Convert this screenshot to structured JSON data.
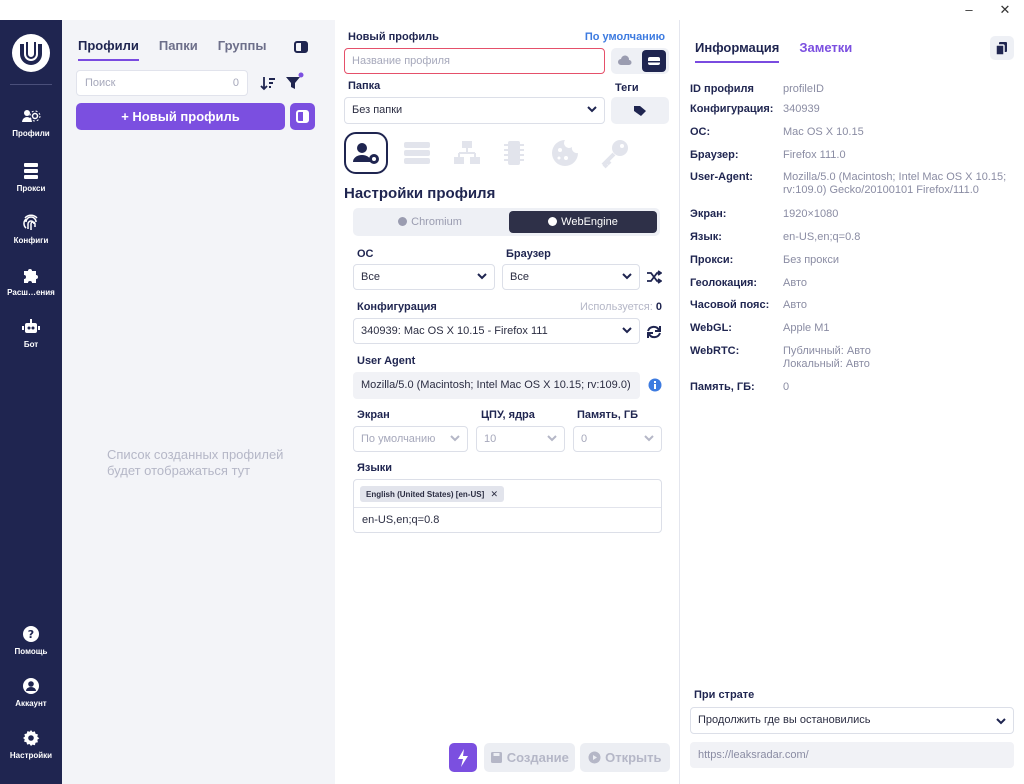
{
  "window": {
    "minimize": "–",
    "close": "✕"
  },
  "sidebar": {
    "items": [
      {
        "label": "Профили",
        "icon": "profiles-icon"
      },
      {
        "label": "Прокси",
        "icon": "proxy-icon"
      },
      {
        "label": "Конфиги",
        "icon": "fingerprint-icon"
      },
      {
        "label": "Расш…ения",
        "icon": "puzzle-icon"
      },
      {
        "label": "Бот",
        "icon": "robot-icon"
      }
    ],
    "bottom": [
      {
        "label": "Помощь",
        "icon": "help-icon"
      },
      {
        "label": "Аккаунт",
        "icon": "account-icon"
      },
      {
        "label": "Настройки",
        "icon": "gear-icon"
      }
    ]
  },
  "profiles": {
    "tabs": [
      "Профили",
      "Папки",
      "Группы"
    ],
    "search_placeholder": "Поиск",
    "search_count": "0",
    "new_profile_label": "+ Новый профиль",
    "empty_message": "Список созданных профилей будет отображаться тут"
  },
  "form": {
    "new_profile_label": "Новый профиль",
    "default_link": "По умолчанию",
    "name_placeholder": "Название профиля",
    "folder_label": "Папка",
    "tags_label": "Теги",
    "folder_value": "Без папки",
    "section_title": "Настройки профиля",
    "engines": [
      "Chromium",
      "WebEngine"
    ],
    "active_engine": "WebEngine",
    "os_label": "ОС",
    "os_value": "Все",
    "browser_label": "Браузер",
    "browser_value": "Все",
    "config_label": "Конфигурация",
    "used_label": "Используется:",
    "used_count": "0",
    "config_value": "340939: Mac OS X 10.15 - Firefox 111",
    "ua_label": "User Agent",
    "ua_value": "Mozilla/5.0 (Macintosh; Intel Mac OS X 10.15; rv:109.0)",
    "screen_label": "Экран",
    "screen_value": "По умолчанию",
    "cpu_label": "ЦПУ, ядра",
    "cpu_value": "10",
    "mem_label": "Память, ГБ",
    "mem_value": "0",
    "langs_label": "Языки",
    "lang_chip": "English (United States) [en-US]",
    "lang_chip_remove": "✕",
    "langs_value": "en-US,en;q=0.8",
    "create_label": "Создание",
    "open_label": "Открыть"
  },
  "info": {
    "tabs": [
      "Информация",
      "Заметки"
    ],
    "rows": [
      {
        "key": "ID профиля",
        "value": "profileID"
      },
      {
        "key": "Конфигурация:",
        "value": "340939"
      },
      {
        "key": "ОС:",
        "value": "Mac OS X 10.15"
      },
      {
        "key": "Браузер:",
        "value": "Firefox 111.0"
      },
      {
        "key": "User-Agent:",
        "value": "Mozilla/5.0 (Macintosh; Intel Mac OS X 10.15; rv:109.0) Gecko/20100101 Firefox/111.0"
      },
      {
        "key": "Экран:",
        "value": "1920×1080"
      },
      {
        "key": "Язык:",
        "value": "en-US,en;q=0.8"
      },
      {
        "key": "Прокси:",
        "value": "Без прокси"
      },
      {
        "key": "Геолокация:",
        "value": "Авто"
      },
      {
        "key": "Часовой пояс:",
        "value": "Авто"
      },
      {
        "key": "WebGL:",
        "value": "Apple M1"
      },
      {
        "key": "WebRTC:",
        "value": "Публичный: Авто",
        "value2": "Локальный: Авто"
      },
      {
        "key": "Память, ГБ:",
        "value": "0"
      }
    ],
    "startup_label": "При страте",
    "startup_value": "Продолжить где вы остановились",
    "url_value": "https://leaksradar.com/"
  },
  "colors": {
    "accent": "#7b4fe0",
    "sidebar": "#1f2550",
    "danger": "#e5506a"
  }
}
